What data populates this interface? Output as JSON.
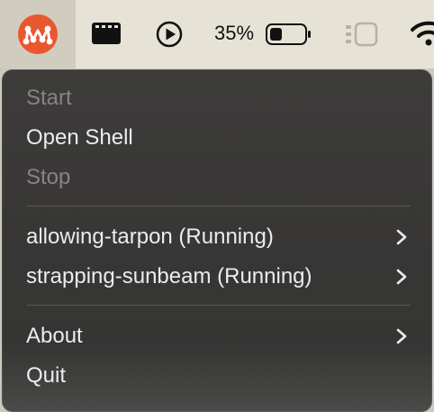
{
  "menubar": {
    "app_icon": "multipass-logo-icon",
    "tray_icons": [
      "clapperboard-icon",
      "play-circle-icon",
      "battery-icon",
      "sidebar-icon",
      "wifi-icon"
    ],
    "battery": {
      "percent_label": "35%",
      "level": 0.35
    },
    "colors": {
      "accent": "#e9572f",
      "bar": "#e6e3d6"
    }
  },
  "menu": {
    "start_label": "Start",
    "open_shell_label": "Open Shell",
    "stop_label": "Stop",
    "instances": [
      {
        "label": "allowing-tarpon (Running)"
      },
      {
        "label": "strapping-sunbeam (Running)"
      }
    ],
    "about_label": "About",
    "quit_label": "Quit"
  }
}
